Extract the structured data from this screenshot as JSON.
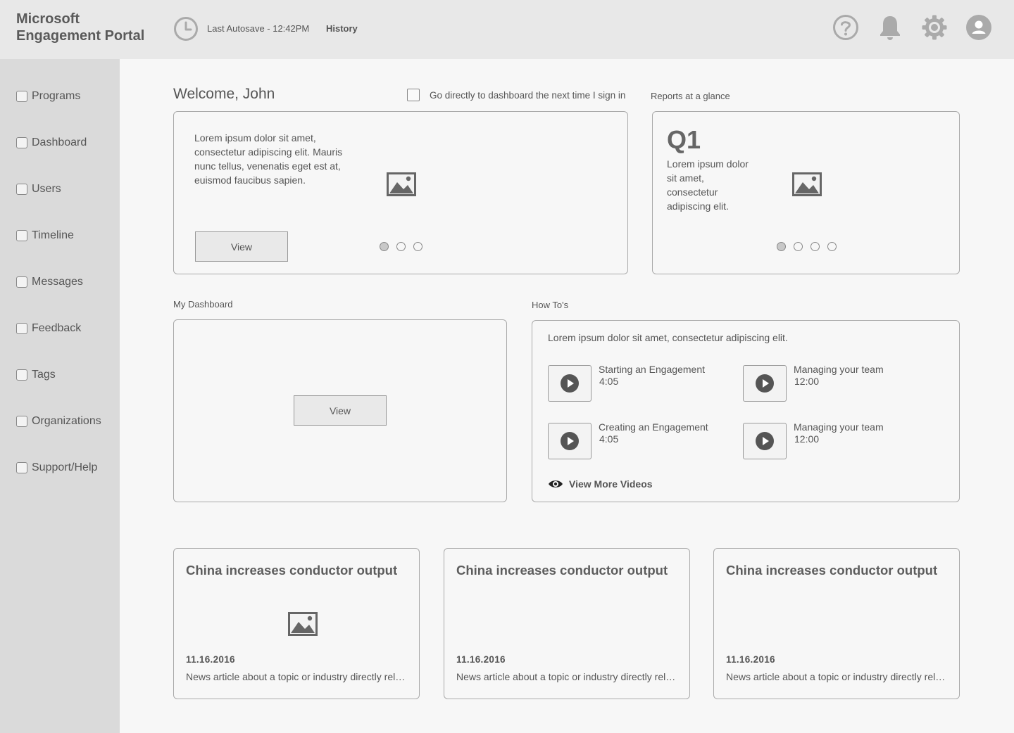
{
  "header": {
    "brand_line1": "Microsoft",
    "brand_line2": "Engagement Portal",
    "autosave": "Last Autosave - 12:42PM",
    "history": "History",
    "icons": [
      "help-icon",
      "bell-icon",
      "gear-icon",
      "user-icon"
    ]
  },
  "sidebar": {
    "items": [
      {
        "label": "Programs"
      },
      {
        "label": "Dashboard"
      },
      {
        "label": "Users"
      },
      {
        "label": "Timeline"
      },
      {
        "label": "Messages"
      },
      {
        "label": "Feedback"
      },
      {
        "label": "Tags"
      },
      {
        "label": "Organizations"
      },
      {
        "label": "Support/Help"
      }
    ]
  },
  "welcome": {
    "title": "Welcome, John",
    "goto_label": "Go directly to dashboard the next time I sign in",
    "text": "Lorem ipsum dolor sit amet, consectetur adipiscing elit. Mauris nunc tellus, venenatis eget est at, euismod faucibus sapien.",
    "button": "View"
  },
  "reports": {
    "label": "Reports at a glance",
    "heading": "Q1",
    "text": "Lorem ipsum dolor sit amet, consectetur adipiscing elit."
  },
  "dashboard": {
    "label": "My Dashboard",
    "button": "View"
  },
  "howtos": {
    "label": "How To's",
    "intro": "Lorem ipsum dolor sit amet, consectetur adipiscing elit.",
    "videos": [
      {
        "title": "Starting an Engagement",
        "duration": "4:05"
      },
      {
        "title": "Managing your team",
        "duration": "12:00"
      },
      {
        "title": "Creating an Engagement",
        "duration": "4:05"
      },
      {
        "title": "Managing your team",
        "duration": "12:00"
      }
    ],
    "more": "View More Videos"
  },
  "news": [
    {
      "title": "China increases conductor output",
      "date": "11.16.2016",
      "summary": "News article about a topic or industry directly related to the engagement"
    },
    {
      "title": "China increases conductor output",
      "date": "11.16.2016",
      "summary": "News article about a topic or industry directly related to the engagement"
    },
    {
      "title": "China increases conductor output",
      "date": "11.16.2016",
      "summary": "News article about a topic or industry directly related to the engagement"
    }
  ],
  "colors": {
    "header_bg": "#e8e8e8",
    "sidebar_bg": "#dadada",
    "page_bg": "#f7f7f7",
    "icon": "#aaaaaa",
    "icon_dark": "#555555"
  }
}
